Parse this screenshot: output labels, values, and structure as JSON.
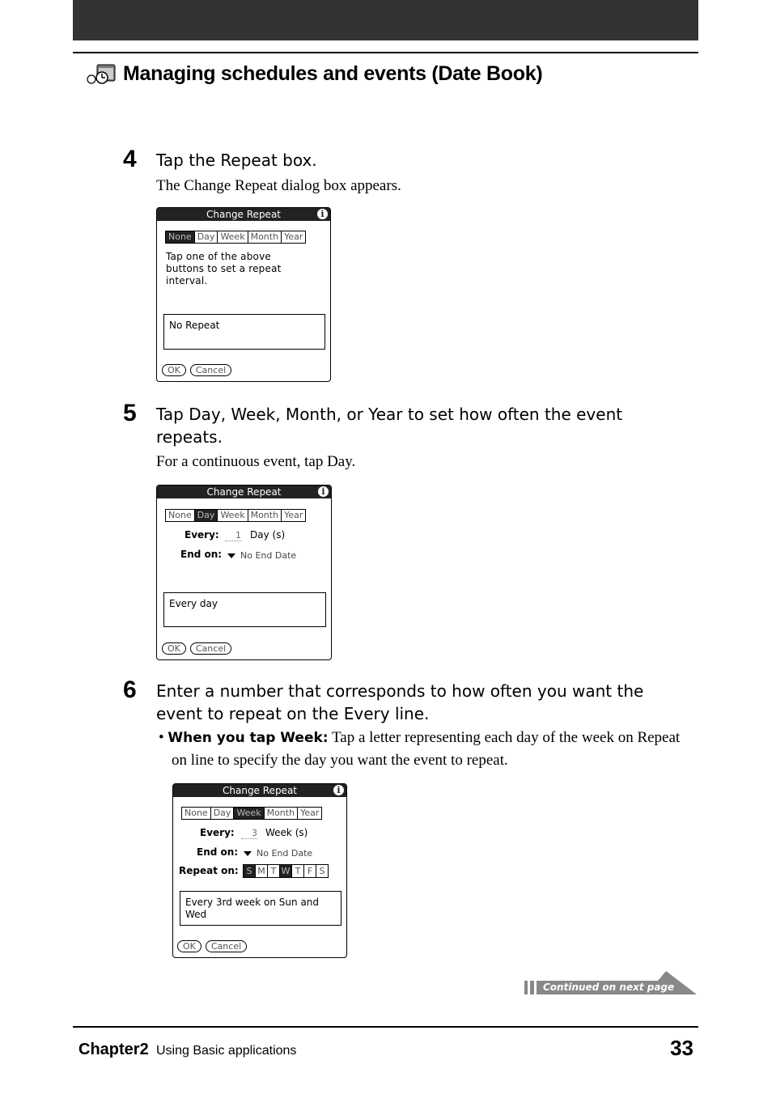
{
  "header": {
    "title": "Managing schedules and events (Date Book)",
    "icon": "date-book-icon"
  },
  "steps": [
    {
      "number": "4",
      "heading": "Tap the Repeat box.",
      "body": "The Change Repeat dialog box appears.",
      "dialog": {
        "title": "Change Repeat",
        "tabs": [
          "None",
          "Day",
          "Week",
          "Month",
          "Year"
        ],
        "selected_tab": "None",
        "message": [
          "Tap one of the above",
          "buttons to set a repeat",
          "interval."
        ],
        "summary": "No Repeat",
        "buttons": [
          "OK",
          "Cancel"
        ]
      }
    },
    {
      "number": "5",
      "heading": "Tap Day, Week, Month, or Year to set how often the event repeats.",
      "body": "For a continuous event, tap Day.",
      "dialog": {
        "title": "Change Repeat",
        "tabs": [
          "None",
          "Day",
          "Week",
          "Month",
          "Year"
        ],
        "selected_tab": "Day",
        "every_label": "Every:",
        "every_value": "1",
        "every_unit": "Day (s)",
        "end_on_label": "End on:",
        "end_on_value": "No End Date",
        "summary": "Every day",
        "buttons": [
          "OK",
          "Cancel"
        ]
      }
    },
    {
      "number": "6",
      "heading": "Enter a number that corresponds to how often you want the event to repeat on the Every line.",
      "bullet_label": "When you tap Week:",
      "bullet_text": " Tap a letter representing each day of the week on Repeat on line to specify the day you want the event to repeat.",
      "dialog": {
        "title": "Change Repeat",
        "tabs": [
          "None",
          "Day",
          "Week",
          "Month",
          "Year"
        ],
        "selected_tab": "Week",
        "every_label": "Every:",
        "every_value": "3",
        "every_unit": "Week (s)",
        "end_on_label": "End on:",
        "end_on_value": "No End Date",
        "repeat_on_label": "Repeat on:",
        "days": [
          "S",
          "M",
          "T",
          "W",
          "T",
          "F",
          "S"
        ],
        "selected_days": [
          0,
          3
        ],
        "summary": [
          "Every 3rd week on Sun and",
          "Wed"
        ],
        "buttons": [
          "OK",
          "Cancel"
        ]
      }
    }
  ],
  "continued": "Continued on next page",
  "footer": {
    "chapter": "Chapter2",
    "section": "Using Basic applications",
    "page": "33"
  }
}
